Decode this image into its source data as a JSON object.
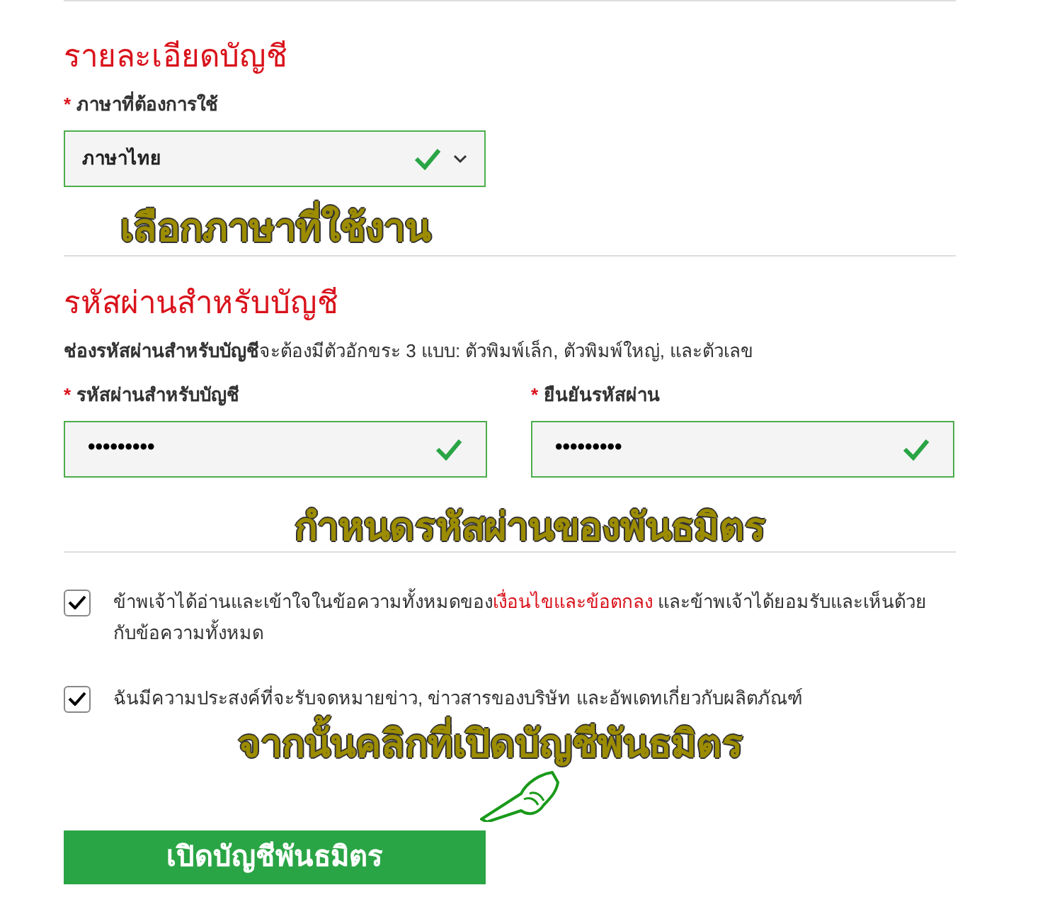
{
  "account_details": {
    "heading": "รายละเอียดบัญชี",
    "language_field": {
      "required_mark": "*",
      "label": "ภาษาที่ต้องการใช้",
      "value": "ภาษาไทย",
      "valid": true
    }
  },
  "annotation_1": "เลือกภาษาที่ใช้งาน",
  "password_section": {
    "heading": "รหัสผ่านสำหรับบัญชี",
    "description": "**ช่องรหัสผ่านสำหรับบัญชี**จะต้องมีตัวอักขระ 3 แบบ: ตัวพิมพ์เล็ก, ตัวพิมพ์ใหญ่, และตัวเลข",
    "fields": [
      {
        "required_mark": "*",
        "label": "รหัสผ่านสำหรับบัญชี",
        "value": "•••••••••",
        "valid": true
      },
      {
        "required_mark": "*",
        "label": "ยืนยันรหัสผ่าน",
        "value": "•••••••••",
        "valid": true
      }
    ]
  },
  "annotation_2": "กำหนดรหัสผ่านของพันธมิตร",
  "consents": [
    {
      "checked": true,
      "text_before": "ข้าพเจ้าได้อ่านและเข้าใจในข้อความทั้งหมดของ",
      "link": "เงื่อนไขและข้อตกลง",
      "text_after": " และข้าพเจ้าได้ยอมรับและเห็นด้วยกับข้อความทั้งหมด"
    },
    {
      "checked": true,
      "text_before": "ฉันมีความประสงค์ที่จะรับจดหมายข่าว, ข่าวสารของบริษัท และอัพเดทเกี่ยวกับผลิตภัณฑ์"
    }
  ],
  "annotation_3": "จากนั้นคลิกที่เปิดบัญชีพันธมิตร",
  "submit_button": "เปิดบัญชีพันธมิตร"
}
